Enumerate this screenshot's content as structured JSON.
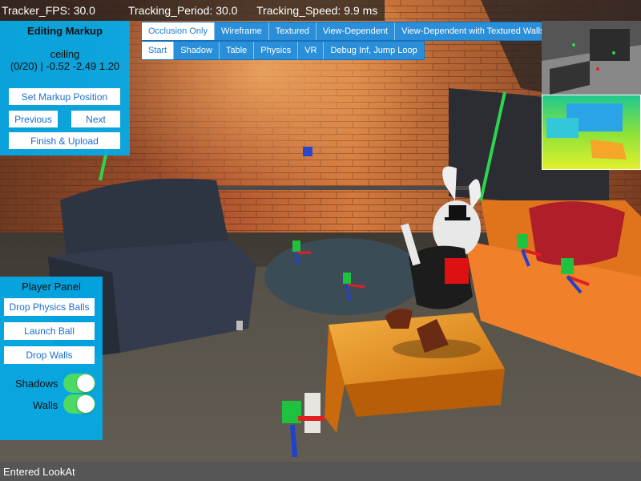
{
  "stats": {
    "fps": "Tracker_FPS: 30.0",
    "period": "Tracking_Period: 30.0",
    "speed": "Tracking_Speed: 9.9 ms"
  },
  "render_modes": [
    "Occlusion Only",
    "Wireframe",
    "Textured",
    "View-Dependent",
    "View-Dependent with Textured Walls"
  ],
  "render_modes_selected": "Occlusion Only",
  "scene_modes": [
    "Start",
    "Shadow",
    "Table",
    "Physics",
    "VR",
    "Debug Inf, Jump Loop"
  ],
  "scene_modes_selected": "Start",
  "markup": {
    "title": "Editing Markup",
    "name": "ceiling",
    "coords": "(0/20) | -0.52 -2.49 1.20",
    "set_position": "Set Markup Position",
    "previous": "Previous",
    "next": "Next",
    "finish": "Finish & Upload"
  },
  "player": {
    "title": "Player Panel",
    "drop_balls": "Drop Physics Balls",
    "launch": "Launch Ball",
    "drop_walls": "Drop Walls",
    "shadows_label": "Shadows",
    "shadows_on": true,
    "walls_label": "Walls",
    "walls_on": true
  },
  "status": "Entered LookAt",
  "colors": {
    "panel": "#00aeef",
    "segment": "#2a8fd8",
    "toggle_on": "#4cd964",
    "status_bar": "#1e1e1e"
  }
}
